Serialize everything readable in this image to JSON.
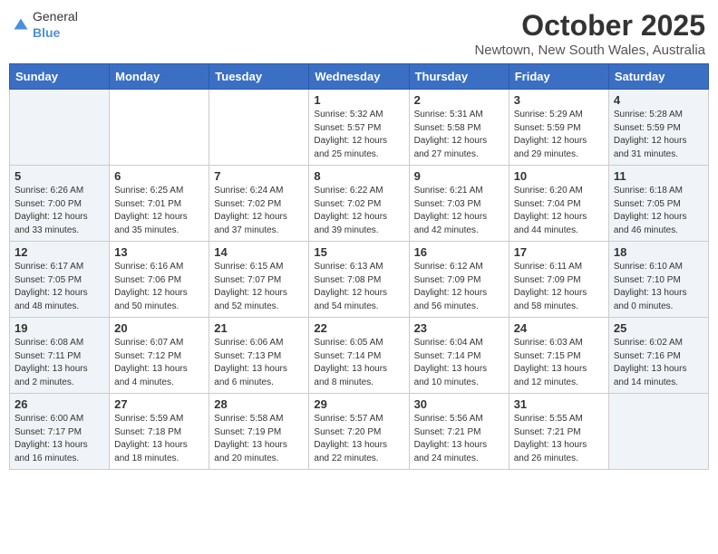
{
  "header": {
    "logo_general": "General",
    "logo_blue": "Blue",
    "month": "October 2025",
    "location": "Newtown, New South Wales, Australia"
  },
  "days_of_week": [
    "Sunday",
    "Monday",
    "Tuesday",
    "Wednesday",
    "Thursday",
    "Friday",
    "Saturday"
  ],
  "weeks": [
    [
      {
        "date": "",
        "text": ""
      },
      {
        "date": "",
        "text": ""
      },
      {
        "date": "",
        "text": ""
      },
      {
        "date": "1",
        "text": "Sunrise: 5:32 AM\nSunset: 5:57 PM\nDaylight: 12 hours\nand 25 minutes."
      },
      {
        "date": "2",
        "text": "Sunrise: 5:31 AM\nSunset: 5:58 PM\nDaylight: 12 hours\nand 27 minutes."
      },
      {
        "date": "3",
        "text": "Sunrise: 5:29 AM\nSunset: 5:59 PM\nDaylight: 12 hours\nand 29 minutes."
      },
      {
        "date": "4",
        "text": "Sunrise: 5:28 AM\nSunset: 5:59 PM\nDaylight: 12 hours\nand 31 minutes."
      }
    ],
    [
      {
        "date": "5",
        "text": "Sunrise: 6:26 AM\nSunset: 7:00 PM\nDaylight: 12 hours\nand 33 minutes."
      },
      {
        "date": "6",
        "text": "Sunrise: 6:25 AM\nSunset: 7:01 PM\nDaylight: 12 hours\nand 35 minutes."
      },
      {
        "date": "7",
        "text": "Sunrise: 6:24 AM\nSunset: 7:02 PM\nDaylight: 12 hours\nand 37 minutes."
      },
      {
        "date": "8",
        "text": "Sunrise: 6:22 AM\nSunset: 7:02 PM\nDaylight: 12 hours\nand 39 minutes."
      },
      {
        "date": "9",
        "text": "Sunrise: 6:21 AM\nSunset: 7:03 PM\nDaylight: 12 hours\nand 42 minutes."
      },
      {
        "date": "10",
        "text": "Sunrise: 6:20 AM\nSunset: 7:04 PM\nDaylight: 12 hours\nand 44 minutes."
      },
      {
        "date": "11",
        "text": "Sunrise: 6:18 AM\nSunset: 7:05 PM\nDaylight: 12 hours\nand 46 minutes."
      }
    ],
    [
      {
        "date": "12",
        "text": "Sunrise: 6:17 AM\nSunset: 7:05 PM\nDaylight: 12 hours\nand 48 minutes."
      },
      {
        "date": "13",
        "text": "Sunrise: 6:16 AM\nSunset: 7:06 PM\nDaylight: 12 hours\nand 50 minutes."
      },
      {
        "date": "14",
        "text": "Sunrise: 6:15 AM\nSunset: 7:07 PM\nDaylight: 12 hours\nand 52 minutes."
      },
      {
        "date": "15",
        "text": "Sunrise: 6:13 AM\nSunset: 7:08 PM\nDaylight: 12 hours\nand 54 minutes."
      },
      {
        "date": "16",
        "text": "Sunrise: 6:12 AM\nSunset: 7:09 PM\nDaylight: 12 hours\nand 56 minutes."
      },
      {
        "date": "17",
        "text": "Sunrise: 6:11 AM\nSunset: 7:09 PM\nDaylight: 12 hours\nand 58 minutes."
      },
      {
        "date": "18",
        "text": "Sunrise: 6:10 AM\nSunset: 7:10 PM\nDaylight: 13 hours\nand 0 minutes."
      }
    ],
    [
      {
        "date": "19",
        "text": "Sunrise: 6:08 AM\nSunset: 7:11 PM\nDaylight: 13 hours\nand 2 minutes."
      },
      {
        "date": "20",
        "text": "Sunrise: 6:07 AM\nSunset: 7:12 PM\nDaylight: 13 hours\nand 4 minutes."
      },
      {
        "date": "21",
        "text": "Sunrise: 6:06 AM\nSunset: 7:13 PM\nDaylight: 13 hours\nand 6 minutes."
      },
      {
        "date": "22",
        "text": "Sunrise: 6:05 AM\nSunset: 7:14 PM\nDaylight: 13 hours\nand 8 minutes."
      },
      {
        "date": "23",
        "text": "Sunrise: 6:04 AM\nSunset: 7:14 PM\nDaylight: 13 hours\nand 10 minutes."
      },
      {
        "date": "24",
        "text": "Sunrise: 6:03 AM\nSunset: 7:15 PM\nDaylight: 13 hours\nand 12 minutes."
      },
      {
        "date": "25",
        "text": "Sunrise: 6:02 AM\nSunset: 7:16 PM\nDaylight: 13 hours\nand 14 minutes."
      }
    ],
    [
      {
        "date": "26",
        "text": "Sunrise: 6:00 AM\nSunset: 7:17 PM\nDaylight: 13 hours\nand 16 minutes."
      },
      {
        "date": "27",
        "text": "Sunrise: 5:59 AM\nSunset: 7:18 PM\nDaylight: 13 hours\nand 18 minutes."
      },
      {
        "date": "28",
        "text": "Sunrise: 5:58 AM\nSunset: 7:19 PM\nDaylight: 13 hours\nand 20 minutes."
      },
      {
        "date": "29",
        "text": "Sunrise: 5:57 AM\nSunset: 7:20 PM\nDaylight: 13 hours\nand 22 minutes."
      },
      {
        "date": "30",
        "text": "Sunrise: 5:56 AM\nSunset: 7:21 PM\nDaylight: 13 hours\nand 24 minutes."
      },
      {
        "date": "31",
        "text": "Sunrise: 5:55 AM\nSunset: 7:21 PM\nDaylight: 13 hours\nand 26 minutes."
      },
      {
        "date": "",
        "text": ""
      }
    ]
  ]
}
